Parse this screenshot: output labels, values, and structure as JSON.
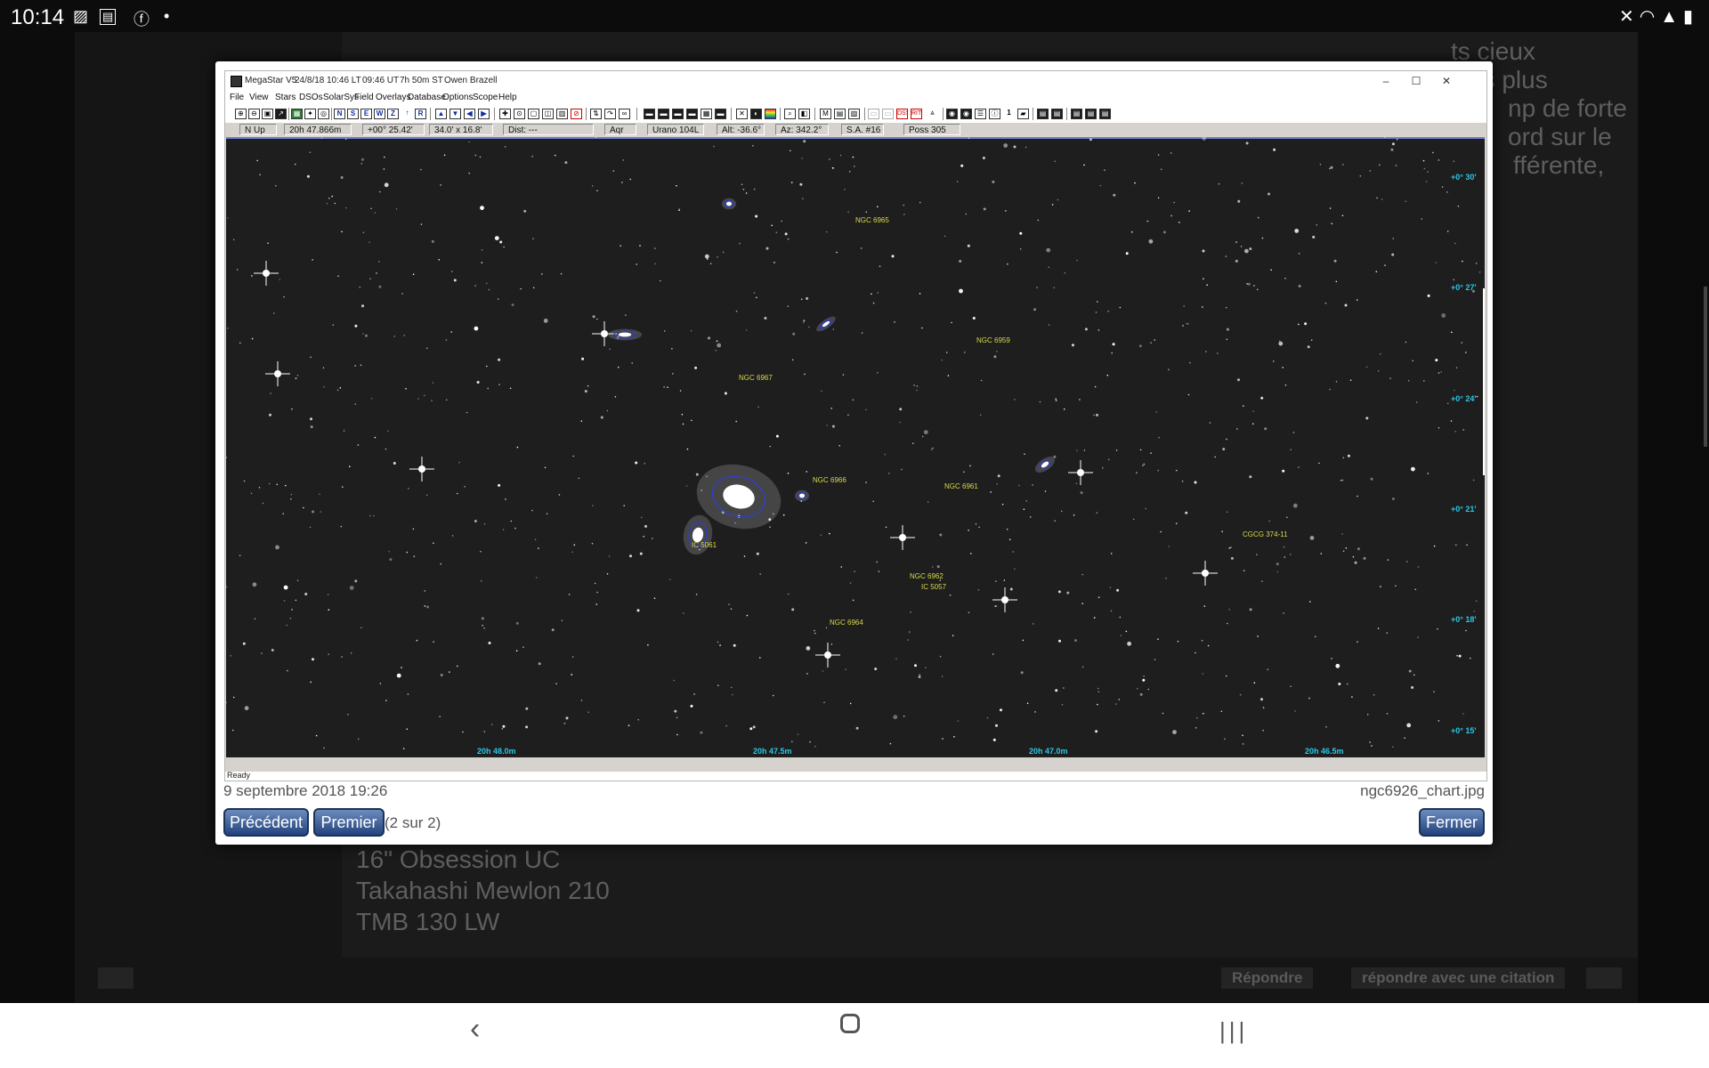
{
  "status_bar": {
    "time": "10:14",
    "icons": [
      "gallery-icon",
      "image-icon",
      "battery-level-icon",
      "facebook-icon",
      "dot-icon",
      "mute-icon",
      "wifi-icon",
      "signal-icon",
      "battery-icon"
    ]
  },
  "forum": {
    "partial_lines": [
      "ts cieux",
      "es plus",
      "np de forte",
      "ord sur le",
      "fférente,"
    ],
    "equipment": [
      "16\" Obsession UC",
      "Takahashi Mewlon 210",
      "TMB 130 LW"
    ],
    "reply_button": "Répondre",
    "quote_button": "répondre avec une citation"
  },
  "megastar": {
    "title": {
      "app": "MegaStar V5",
      "date": "24/8/18",
      "local_time": "10:46 LT",
      "ut": "09:46 UT",
      "st": "7h 50m ST",
      "user": "Owen Brazell"
    },
    "window_controls": {
      "minimize": "–",
      "maximize": "☐",
      "close": "✕"
    },
    "menu": [
      "File",
      "View",
      "Stars",
      "DSOs",
      "SolarSys",
      "Field",
      "Overlays",
      "Database",
      "Options",
      "Scope",
      "Help"
    ],
    "toolbar_letters": [
      "N",
      "S",
      "E",
      "W",
      "Z",
      "R"
    ],
    "info": {
      "orientation": "N Up",
      "ra": "20h 47.866m",
      "dec": "+00° 25.42'",
      "fov": "34.0' x 16.8'",
      "dist": "Dist: ---",
      "constellation": "Aqr",
      "atlas": "Urano 104L",
      "alt": "Alt: -36.6°",
      "az": "Az: 342.2°",
      "sky_atlas": "S.A. #16",
      "poss": "Poss 305"
    },
    "objects": [
      "NGC 6965",
      "NGC 6959",
      "NGC 6967",
      "NGC 6966",
      "NGC 6961",
      "IC 5061",
      "CGCG 374-11",
      "NGC 6962",
      "IC 5057",
      "NGC 6964"
    ],
    "ra_ticks": [
      "20h 48.0m",
      "20h 47.5m",
      "20h 47.0m",
      "20h 46.5m"
    ],
    "dec_ticks": [
      "+0° 30'",
      "+0° 27'",
      "+0° 24'",
      "+0° 21'",
      "+0° 18'",
      "+0° 15'"
    ],
    "status": "Ready"
  },
  "lightbox": {
    "date": "9 septembre 2018 19:26",
    "filename": "ngc6926_chart.jpg",
    "prev_button": "Précédent",
    "first_button": "Premier",
    "counter": "(2 sur 2)",
    "close_button": "Fermer"
  },
  "colors": {
    "label_yellow": "#d9d94a",
    "tick_cyan": "#27c8e8",
    "button_blue": "#34528a",
    "galaxy_ellipse": "#2d3fd0"
  }
}
